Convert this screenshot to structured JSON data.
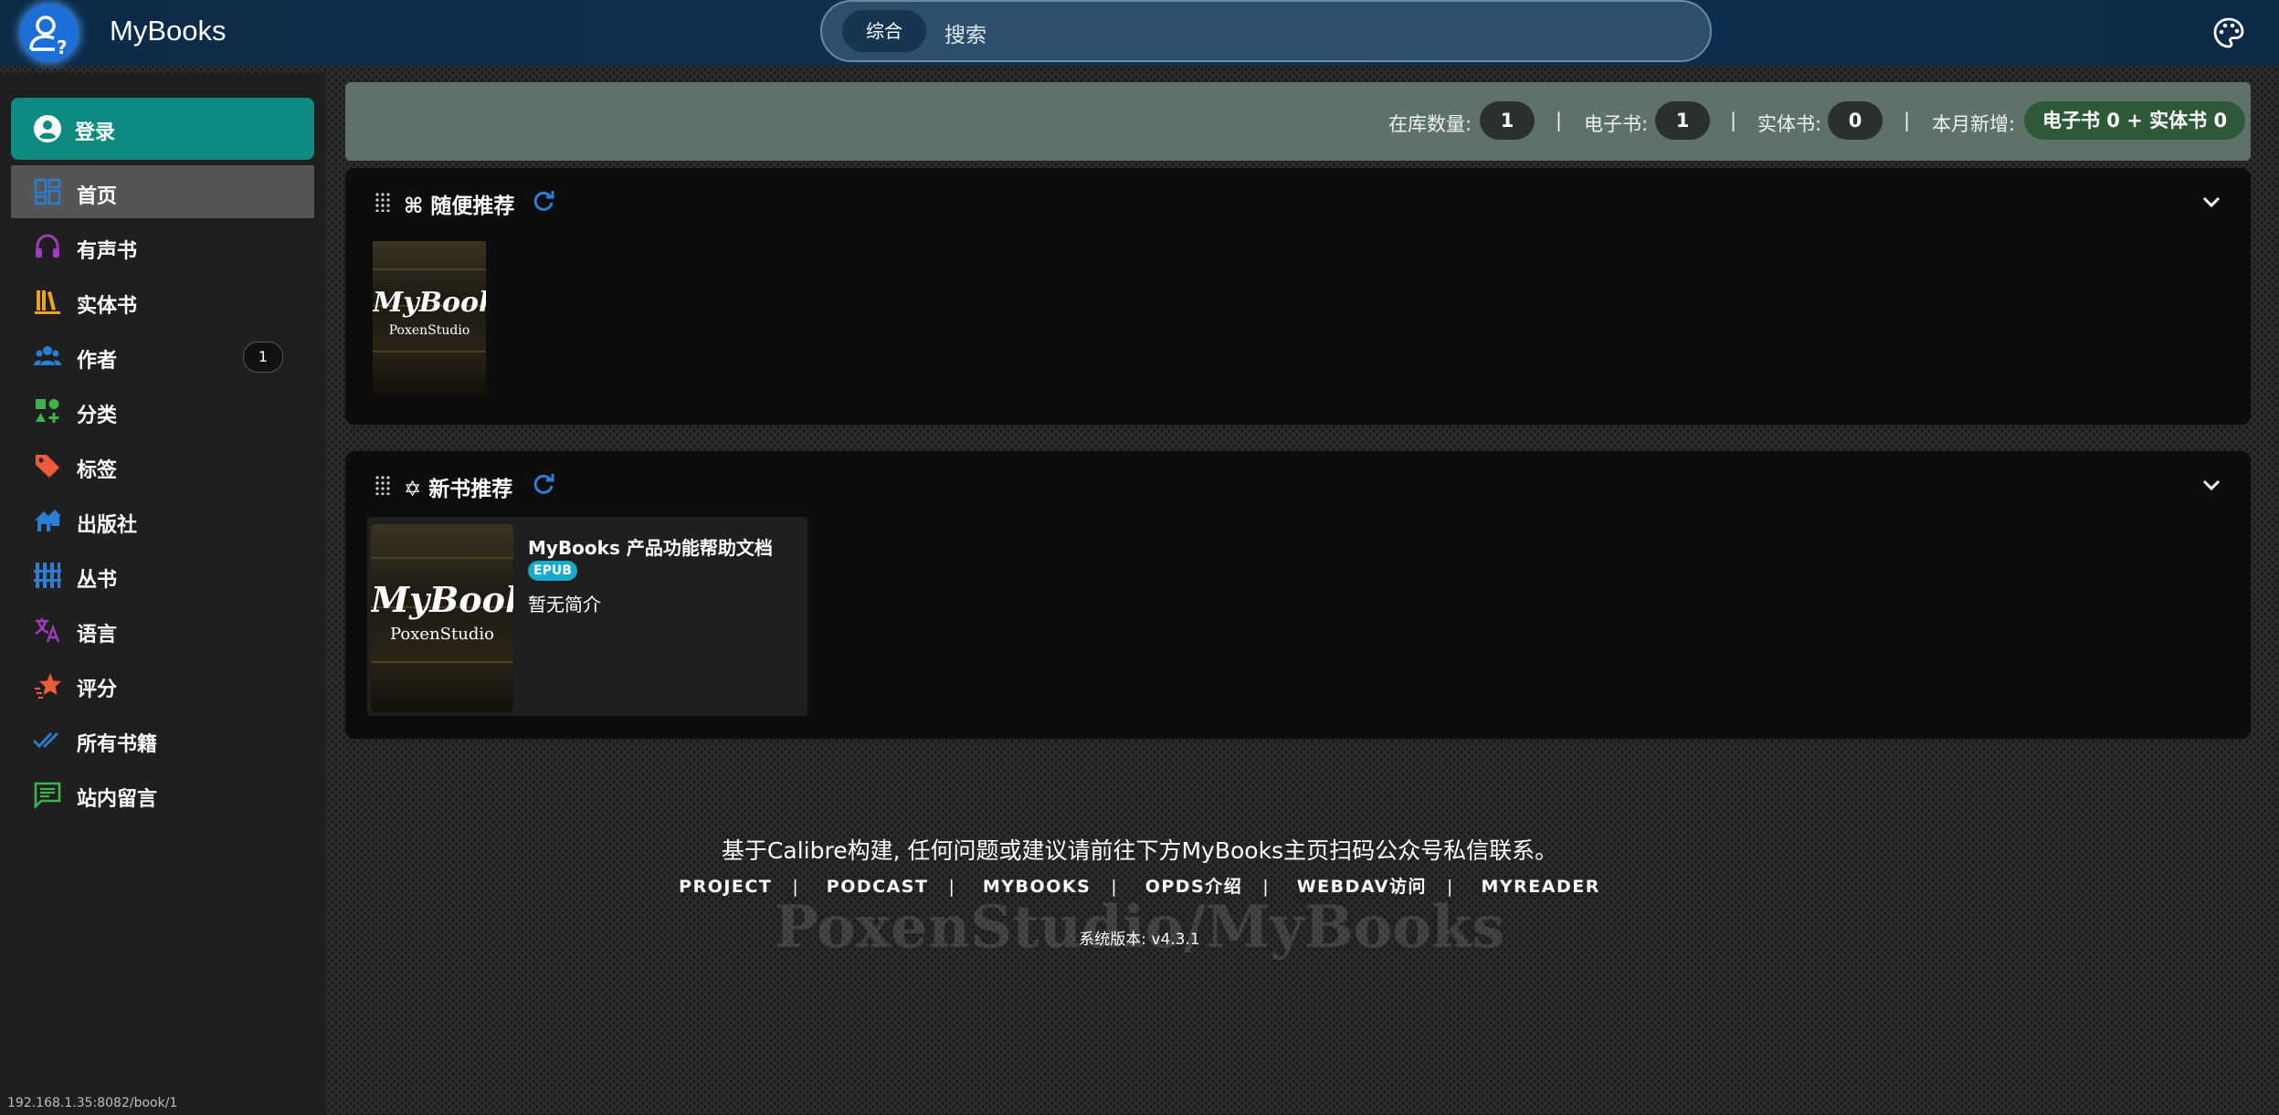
{
  "header": {
    "brand": "MyBooks",
    "search_chip": "综合",
    "search_placeholder": "搜索"
  },
  "sidebar": {
    "login_label": "登录",
    "items": [
      {
        "label": "首页",
        "icon": "dashboard-icon",
        "active": true
      },
      {
        "label": "有声书",
        "icon": "headphones-icon"
      },
      {
        "label": "实体书",
        "icon": "bookshelf-icon"
      },
      {
        "label": "作者",
        "icon": "people-icon",
        "badge": "1"
      },
      {
        "label": "分类",
        "icon": "shapes-icon"
      },
      {
        "label": "标签",
        "icon": "tag-icon"
      },
      {
        "label": "出版社",
        "icon": "house-icon"
      },
      {
        "label": "丛书",
        "icon": "series-icon"
      },
      {
        "label": "语言",
        "icon": "translate-icon"
      },
      {
        "label": "评分",
        "icon": "star-icon"
      },
      {
        "label": "所有书籍",
        "icon": "double-check-icon"
      },
      {
        "label": "站内留言",
        "icon": "message-icon"
      }
    ]
  },
  "stats": {
    "total_label": "在库数量:",
    "total_value": "1",
    "ebook_label": "电子书:",
    "ebook_value": "1",
    "physical_label": "实体书:",
    "physical_value": "0",
    "month_label": "本月新增:",
    "month_value": "电子书 0 + 实体书 0",
    "separator": "|"
  },
  "random_panel": {
    "title": "⌘ 随便推荐"
  },
  "new_panel": {
    "title": "✡ 新书推荐",
    "book": {
      "title": "MyBooks 产品功能帮助文档",
      "format": "EPUB",
      "description": "暂无简介"
    }
  },
  "cover": {
    "title": "MyBooks",
    "subtitle": "PoxenStudio"
  },
  "footer": {
    "text": "基于Calibre构建, 任何问题或建议请前往下方MyBooks主页扫码公众号私信联系。",
    "links": [
      "PROJECT",
      "PODCAST",
      "MYBOOKS",
      "OPDS介绍",
      "WEBDAV访问",
      "MYREADER"
    ],
    "watermark": "PoxenStudio/MyBooks",
    "version": "系统版本: v4.3.1"
  },
  "status_url": "192.168.1.35:8082/book/1",
  "colors": {
    "header": "#0e3355",
    "login": "#0e8a80",
    "accent_blue": "#2a7fd4",
    "epub_badge": "#18a9c8"
  }
}
